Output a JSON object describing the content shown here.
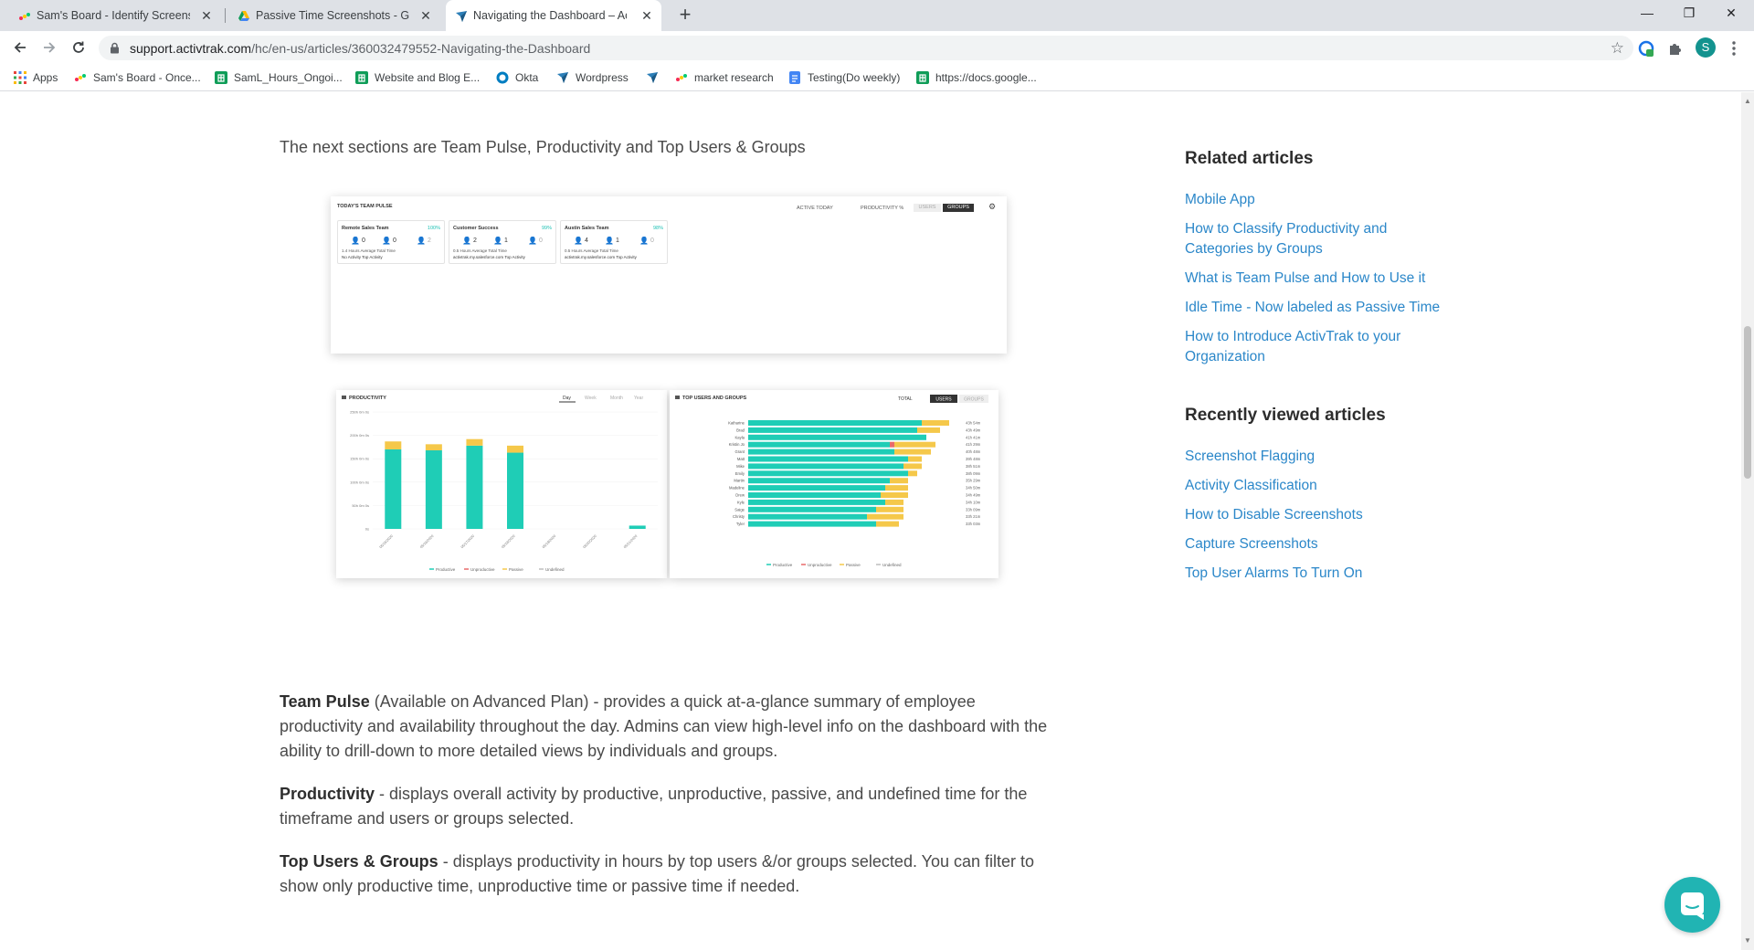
{
  "browser": {
    "tabs": [
      {
        "title": "Sam's Board - Identify Screenshot",
        "icon": "monday-icon"
      },
      {
        "title": "Passive Time Screenshots - Goog",
        "icon": "google-drive-icon"
      },
      {
        "title": "Navigating the Dashboard – Acti",
        "icon": "activtrak-icon"
      }
    ],
    "url_host": "support.activtrak.com",
    "url_path": "/hc/en-us/articles/360032479552-Navigating-the-Dashboard",
    "profile_initial": "S",
    "bookmarks": [
      {
        "label": "Apps",
        "icon": "apps-grid-icon"
      },
      {
        "label": "Sam's Board - Once...",
        "icon": "monday-icon"
      },
      {
        "label": "SamL_Hours_Ongoi...",
        "icon": "sheets-icon"
      },
      {
        "label": "Website and Blog E...",
        "icon": "sheets-icon"
      },
      {
        "label": "Okta",
        "icon": "okta-icon"
      },
      {
        "label": "Wordpress",
        "icon": "activtrak-icon"
      },
      {
        "label": "",
        "icon": "activtrak-icon"
      },
      {
        "label": "market research",
        "icon": "monday-icon"
      },
      {
        "label": "Testing(Do weekly)",
        "icon": "docs-icon"
      },
      {
        "label": "https://docs.google...",
        "icon": "sheets-icon"
      }
    ]
  },
  "article": {
    "intro": "The next sections are Team Pulse, Productivity and Top Users & Groups",
    "team_pulse_title": "Team Pulse",
    "team_pulse_text": " (Available on Advanced Plan) - provides a quick at-a-glance summary of employee productivity and availability throughout the day. Admins can view high-level info on the dashboard with the ability to drill-down to more detailed views by individuals and groups.",
    "productivity_title": "Productivity",
    "productivity_text": " - displays overall activity by productive, unproductive, passive, and undefined time for the timeframe and users or groups selected.",
    "top_users_title": "Top Users & Groups",
    "top_users_text": " - displays productivity in hours by top users &/or groups selected. You can filter to show only productive time, unproductive time or passive time if needed."
  },
  "sidebar": {
    "related_heading": "Related articles",
    "related": [
      "Mobile App",
      "How to Classify Productivity and Categories by Groups",
      "What is Team Pulse and How to Use it",
      "Idle Time - Now labeled as Passive Time",
      "How to Introduce ActivTrak to your Organization"
    ],
    "recent_heading": "Recently viewed articles",
    "recent": [
      "Screenshot Flagging",
      "Activity Classification",
      "How to Disable Screenshots",
      "Capture Screenshots",
      "Top User Alarms To Turn On"
    ]
  },
  "team_pulse_shot": {
    "title": "TODAY'S TEAM PULSE",
    "controls": [
      "ACTIVE TODAY",
      "PRODUCTIVITY %",
      "USERS",
      "GROUPS"
    ],
    "cards": [
      {
        "name": "Remote Sales Team",
        "pct": "100%",
        "active": "0",
        "passive": "0",
        "offline": "2",
        "hours": "1.4 Hours Average Total Time",
        "activity": "No Activity Top Activity"
      },
      {
        "name": "Customer Success",
        "pct": "99%",
        "active": "2",
        "passive": "1",
        "offline": "0",
        "hours": "0.5 Hours Average Total Time",
        "activity": "activtrak.my.salesforce.com Top Activity"
      },
      {
        "name": "Austin Sales Team",
        "pct": "98%",
        "active": "4",
        "passive": "1",
        "offline": "0",
        "hours": "0.5 Hours Average Total Time",
        "activity": "activtrak.my.salesforce.com Top Activity"
      }
    ],
    "colors": {
      "accent": "#1fc1b5",
      "passive": "#f5c84a"
    }
  },
  "chart_data": [
    {
      "type": "bar",
      "title": "PRODUCTIVITY",
      "tabs": [
        "Day",
        "Week",
        "Month",
        "Year"
      ],
      "categories": [
        "05/15/2020",
        "05/16/2020",
        "05/17/2020",
        "05/18/2020",
        "05/19/2020",
        "05/20/2020",
        "05/21/2020"
      ],
      "series": [
        {
          "name": "Productive",
          "values": [
            170,
            168,
            178,
            163,
            0,
            0,
            7
          ],
          "color": "#1fcdb6"
        },
        {
          "name": "Unproductive",
          "values": [
            0,
            0,
            0,
            0,
            0,
            0,
            0
          ],
          "color": "#e86b6b"
        },
        {
          "name": "Passive",
          "values": [
            17,
            13,
            14,
            15,
            0,
            0,
            0
          ],
          "color": "#f5c84a"
        },
        {
          "name": "Undefined",
          "values": [
            0,
            0,
            0,
            0,
            0,
            0,
            0
          ],
          "color": "#bdbdbd"
        }
      ],
      "ytick_labels": [
        "250h 0m 0s",
        "200h 0m 0s",
        "150h 0m 0s",
        "100h 0m 0s",
        "50h 0m 0s",
        "0s"
      ],
      "ylim": [
        0,
        250
      ]
    },
    {
      "type": "bar",
      "orientation": "horizontal",
      "title": "TOP USERS AND GROUPS",
      "tabs": [
        "TOTAL",
        "USERS",
        "GROUPS"
      ],
      "categories": [
        "Katharine",
        "Brad",
        "Kayla",
        "Kristin Jo",
        "Grant",
        "Matt",
        "Mike",
        "Emily",
        "Martin",
        "Madeline",
        "Drew",
        "Kyle",
        "Saige",
        "Christy",
        "Tyler"
      ],
      "series": [
        {
          "name": "Productive",
          "values": [
            38,
            37,
            39,
            31,
            32,
            35,
            34,
            35,
            31,
            30,
            29,
            30,
            28,
            26,
            28
          ],
          "color": "#1fcdb6"
        },
        {
          "name": "Unproductive",
          "values": [
            0,
            0,
            0,
            1,
            0,
            0,
            0,
            0,
            0,
            0,
            0,
            0,
            0,
            0,
            0
          ],
          "color": "#e86b6b"
        },
        {
          "name": "Passive",
          "values": [
            6,
            5,
            0,
            9,
            8,
            3,
            4,
            2,
            4,
            5,
            6,
            4,
            6,
            8,
            5
          ],
          "color": "#f5c84a"
        },
        {
          "name": "Undefined",
          "values": [
            0,
            0,
            0,
            0,
            0,
            0,
            0,
            0,
            0,
            0,
            0,
            0,
            0,
            0,
            0
          ],
          "color": "#bdbdbd"
        }
      ],
      "value_labels": [
        "43h 54m",
        "43h 49m",
        "41h 41m",
        "41h 29m",
        "40h 48m",
        "39h 48m",
        "38h 51m",
        "38h 09m",
        "35h 29m",
        "34h 50m",
        "34h 49m",
        "34h 10m",
        "33h 09m",
        "33h 21m",
        "33h 03m"
      ]
    }
  ],
  "chat_icon": "chat-bubble-icon"
}
